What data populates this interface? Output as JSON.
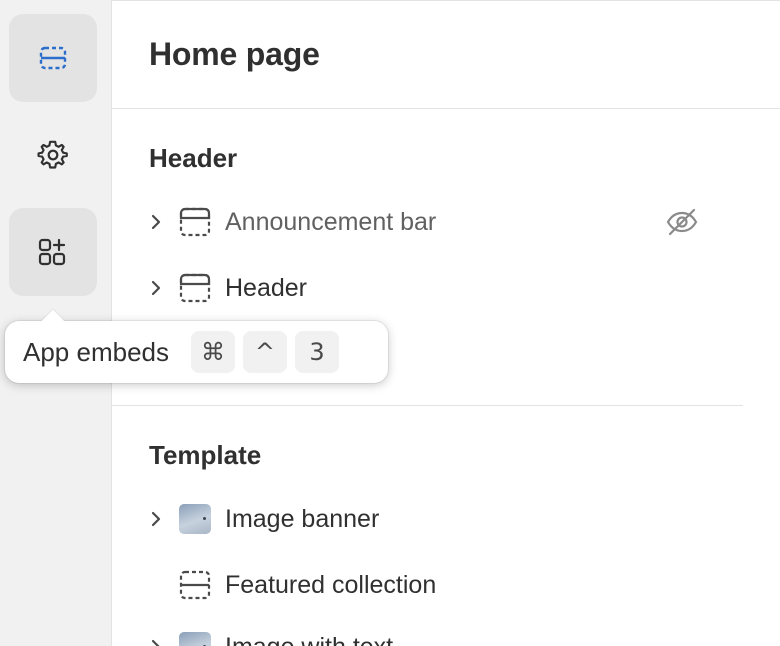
{
  "rail": {
    "items": [
      {
        "icon": "sections-icon",
        "active": true
      },
      {
        "icon": "gear-icon",
        "active": false
      },
      {
        "icon": "app-blocks-icon",
        "active": false
      }
    ]
  },
  "page": {
    "title": "Home page"
  },
  "sections": {
    "header": {
      "title": "Header",
      "items": [
        {
          "label": "Announcement bar",
          "icon": "section-layout-icon",
          "hidden": true
        },
        {
          "label": "Header",
          "icon": "section-layout-icon",
          "hidden": false
        }
      ]
    },
    "template": {
      "title": "Template",
      "items": [
        {
          "label": "Image banner",
          "icon": "image-thumbnail"
        },
        {
          "label": "Featured collection",
          "icon": "section-layout-icon"
        },
        {
          "label": "Image with text",
          "icon": "image-thumbnail"
        }
      ]
    }
  },
  "tooltip": {
    "label": "App embeds",
    "keys": [
      "⌘",
      "^",
      "3"
    ]
  },
  "colors": {
    "accent": "#2c6ecb",
    "text": "#303030",
    "muted": "#616161"
  }
}
